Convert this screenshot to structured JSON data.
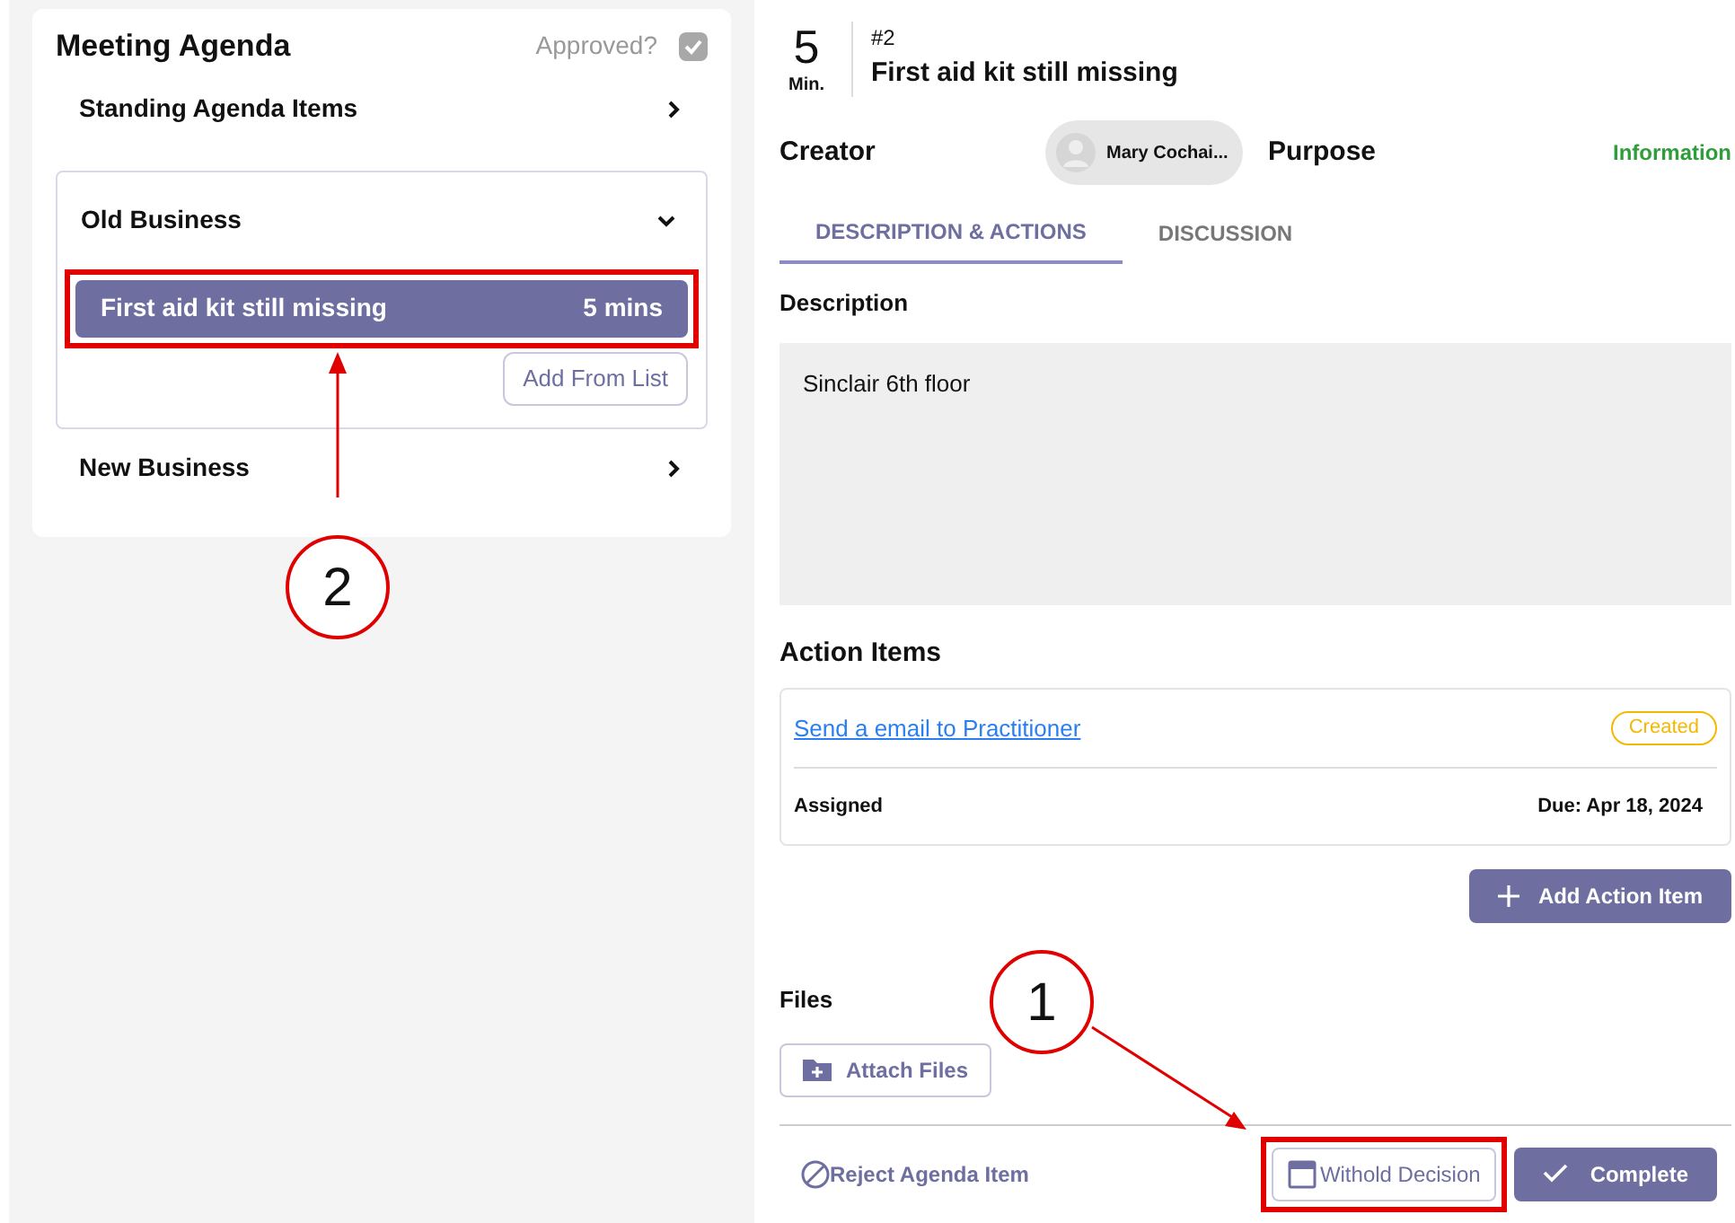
{
  "agenda": {
    "title": "Meeting Agenda",
    "approved_label": "Approved?",
    "approved": true,
    "sections": [
      {
        "title": "Standing Agenda Items",
        "expanded": false
      },
      {
        "title": "Old Business",
        "expanded": true,
        "items": [
          {
            "title": "First aid kit still missing",
            "duration": "5 mins",
            "selected": true,
            "highlighted": true
          }
        ],
        "add_button": "Add From List"
      },
      {
        "title": "New Business",
        "expanded": false
      }
    ]
  },
  "item": {
    "minutes": "5",
    "minutes_unit": "Min.",
    "number": "#2",
    "title": "First aid kit still missing",
    "creator_label": "Creator",
    "creator": "Mary Cochai...",
    "purpose_label": "Purpose",
    "purpose": "Information",
    "tabs": [
      {
        "label": "DESCRIPTION & ACTIONS",
        "selected": true
      },
      {
        "label": "DISCUSSION",
        "selected": false
      }
    ],
    "description_label": "Description",
    "description": "Sinclair 6th floor",
    "action_items_label": "Action Items",
    "action_items": [
      {
        "title": "Send a email to Practitioner",
        "status": "Created",
        "color": "#f5b800",
        "assigned": "Assigned",
        "due": "Due: Apr 18, 2024"
      }
    ],
    "add_action_button": "Add Action Item",
    "files_label": "Files",
    "attach_button": "Attach Files",
    "reject_button": "Reject Agenda Item",
    "withhold_button": {
      "label": "Withold Decision",
      "highlighted": true
    },
    "complete_button": "Complete"
  },
  "callouts": [
    {
      "number": "2"
    },
    {
      "number": "1"
    }
  ]
}
